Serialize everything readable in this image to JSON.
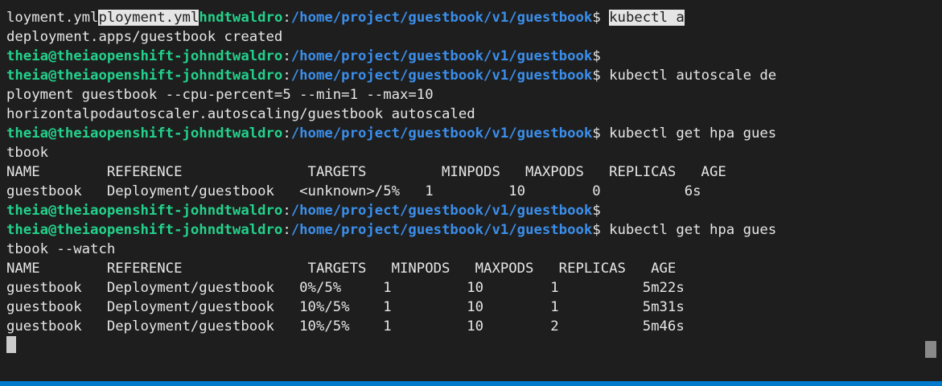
{
  "prompt": {
    "user": "theia@theiaopenshift-johndtwaldro",
    "colon": ":",
    "path": "/home/project/guestbook/v1/guestbook",
    "dollar": "$"
  },
  "line0": {
    "prefix": "loyment.yml",
    "selected_fragment": "ployment.yml",
    "user_tail": "hndtwaldro",
    "command_selected": "kubectl a"
  },
  "outputs": {
    "deployment_created": "deployment.apps/guestbook created",
    "autoscale_wrap": "ployment guestbook --cpu-percent=5 --min=1 --max=10",
    "hpa_autoscaled": "horizontalpodautoscaler.autoscaling/guestbook autoscaled",
    "get_hpa_wrap": "tbook",
    "watch_wrap": "tbook --watch"
  },
  "commands": {
    "autoscale": " kubectl autoscale de",
    "get_hpa": " kubectl get hpa gues",
    "get_hpa_watch": " kubectl get hpa gues"
  },
  "hpa_table": {
    "header": "NAME        REFERENCE               TARGETS         MINPODS   MAXPODS   REPLICAS   AGE",
    "rows": [
      "guestbook   Deployment/guestbook   <unknown>/5%   1         10        0          6s"
    ]
  },
  "watch_table": {
    "header": "NAME        REFERENCE               TARGETS   MINPODS   MAXPODS   REPLICAS   AGE",
    "rows": [
      "guestbook   Deployment/guestbook   0%/5%     1         10        1          5m22s",
      "guestbook   Deployment/guestbook   10%/5%    1         10        1          5m31s",
      "guestbook   Deployment/guestbook   10%/5%    1         10        2          5m46s"
    ]
  },
  "colors": {
    "background": "#1e1e1e",
    "foreground": "#e6e6e6",
    "user_green": "#23d18b",
    "path_blue": "#3b8eea",
    "accent_blue": "#007acc"
  }
}
